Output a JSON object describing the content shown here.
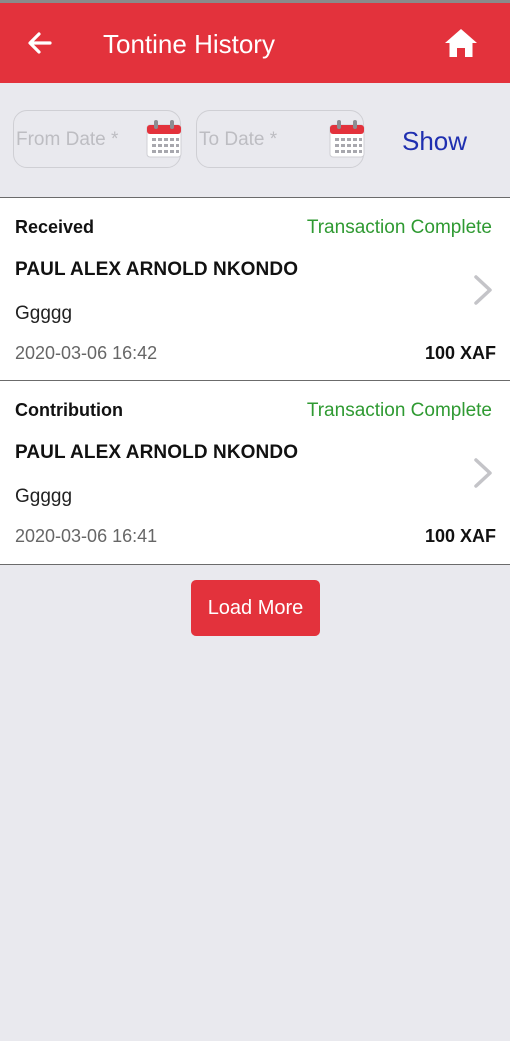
{
  "header": {
    "title": "Tontine History",
    "back_icon": "back-arrow-icon",
    "home_icon": "home-icon"
  },
  "filter": {
    "from_placeholder": "From Date *",
    "to_placeholder": "To Date *",
    "from_value": "",
    "to_value": "",
    "calendar_icon": "calendar-icon",
    "show_label": "Show"
  },
  "transactions": [
    {
      "type": "Received",
      "status": "Transaction Complete",
      "name": "PAUL ALEX ARNOLD NKONDO",
      "note": "Ggggg",
      "datetime": "2020-03-06  16:42",
      "amount": "100 XAF"
    },
    {
      "type": "Contribution",
      "status": "Transaction Complete",
      "name": "PAUL ALEX ARNOLD NKONDO",
      "note": "Ggggg",
      "datetime": "2020-03-06  16:41",
      "amount": "100 XAF"
    }
  ],
  "load_more_label": "Load More",
  "colors": {
    "primary": "#e3323c",
    "status_complete": "#2f9a32",
    "link": "#1f2fb0",
    "background": "#e9e9ee"
  }
}
